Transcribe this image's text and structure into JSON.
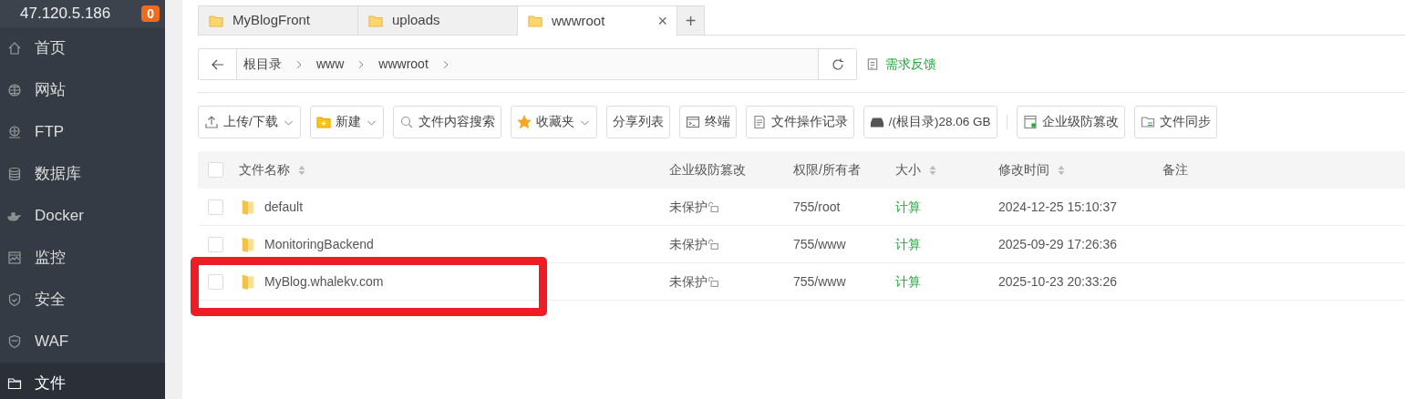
{
  "sidebar": {
    "host": "47.120.5.186",
    "badge": "0",
    "items": [
      {
        "label": "首页",
        "kind": "home",
        "selected": false
      },
      {
        "label": "网站",
        "kind": "globe",
        "selected": false
      },
      {
        "label": "FTP",
        "kind": "ftp",
        "selected": false
      },
      {
        "label": "数据库",
        "kind": "database",
        "selected": false
      },
      {
        "label": "Docker",
        "kind": "docker",
        "selected": false
      },
      {
        "label": "监控",
        "kind": "monitor",
        "selected": false
      },
      {
        "label": "安全",
        "kind": "shield",
        "selected": false
      },
      {
        "label": "WAF",
        "kind": "waf",
        "selected": false
      },
      {
        "label": "文件",
        "kind": "folder",
        "selected": true
      }
    ]
  },
  "tabs": [
    {
      "label": "MyBlogFront",
      "selected": false
    },
    {
      "label": "uploads",
      "selected": false
    },
    {
      "label": "wwwroot",
      "selected": true,
      "close": "×"
    }
  ],
  "add_tab": "+",
  "breadcrumb": {
    "segments": [
      "根目录",
      "www",
      "wwwroot"
    ]
  },
  "feedback": "需求反馈",
  "toolbar": [
    {
      "label": "上传/下载",
      "kind": "upload",
      "dropdown": true
    },
    {
      "label": "新建",
      "kind": "newfolder",
      "dropdown": true
    },
    {
      "label": "文件内容搜索",
      "kind": "search",
      "dropdown": false
    },
    {
      "label": "收藏夹",
      "kind": "star",
      "dropdown": true
    },
    {
      "label": "分享列表",
      "kind": "plain",
      "dropdown": false
    },
    {
      "label": "终端",
      "kind": "terminal",
      "dropdown": false
    },
    {
      "label": "文件操作记录",
      "kind": "log",
      "dropdown": false
    },
    {
      "label": "/(根目录)28.06 GB",
      "kind": "disk",
      "dropdown": false
    },
    {
      "label": "企业级防篡改",
      "kind": "tamper",
      "dropdown": false,
      "separator_before": true
    },
    {
      "label": "文件同步",
      "kind": "sync",
      "dropdown": false
    }
  ],
  "table": {
    "columns": [
      {
        "label": "文件名称",
        "sortable": true
      },
      {
        "label": "企业级防篡改",
        "sortable": false
      },
      {
        "label": "权限/所有者",
        "sortable": false
      },
      {
        "label": "大小",
        "sortable": true
      },
      {
        "label": "修改时间",
        "sortable": true
      },
      {
        "label": "备注",
        "sortable": false
      }
    ],
    "header_checked": false,
    "rows": [
      {
        "name": "default",
        "protection": "未保护",
        "permission": "755/root",
        "size": "计算",
        "modified": "2024-12-25 15:10:37",
        "checked": false,
        "highlighted": false
      },
      {
        "name": "MonitoringBackend",
        "protection": "未保护",
        "permission": "755/www",
        "size": "计算",
        "modified": "2025-09-29 17:26:36",
        "checked": false,
        "highlighted": false
      },
      {
        "name": "MyBlog.whalekv.com",
        "protection": "未保护",
        "permission": "755/www",
        "size": "计算",
        "modified": "2025-10-23 20:33:26",
        "checked": false,
        "highlighted": true
      }
    ]
  }
}
